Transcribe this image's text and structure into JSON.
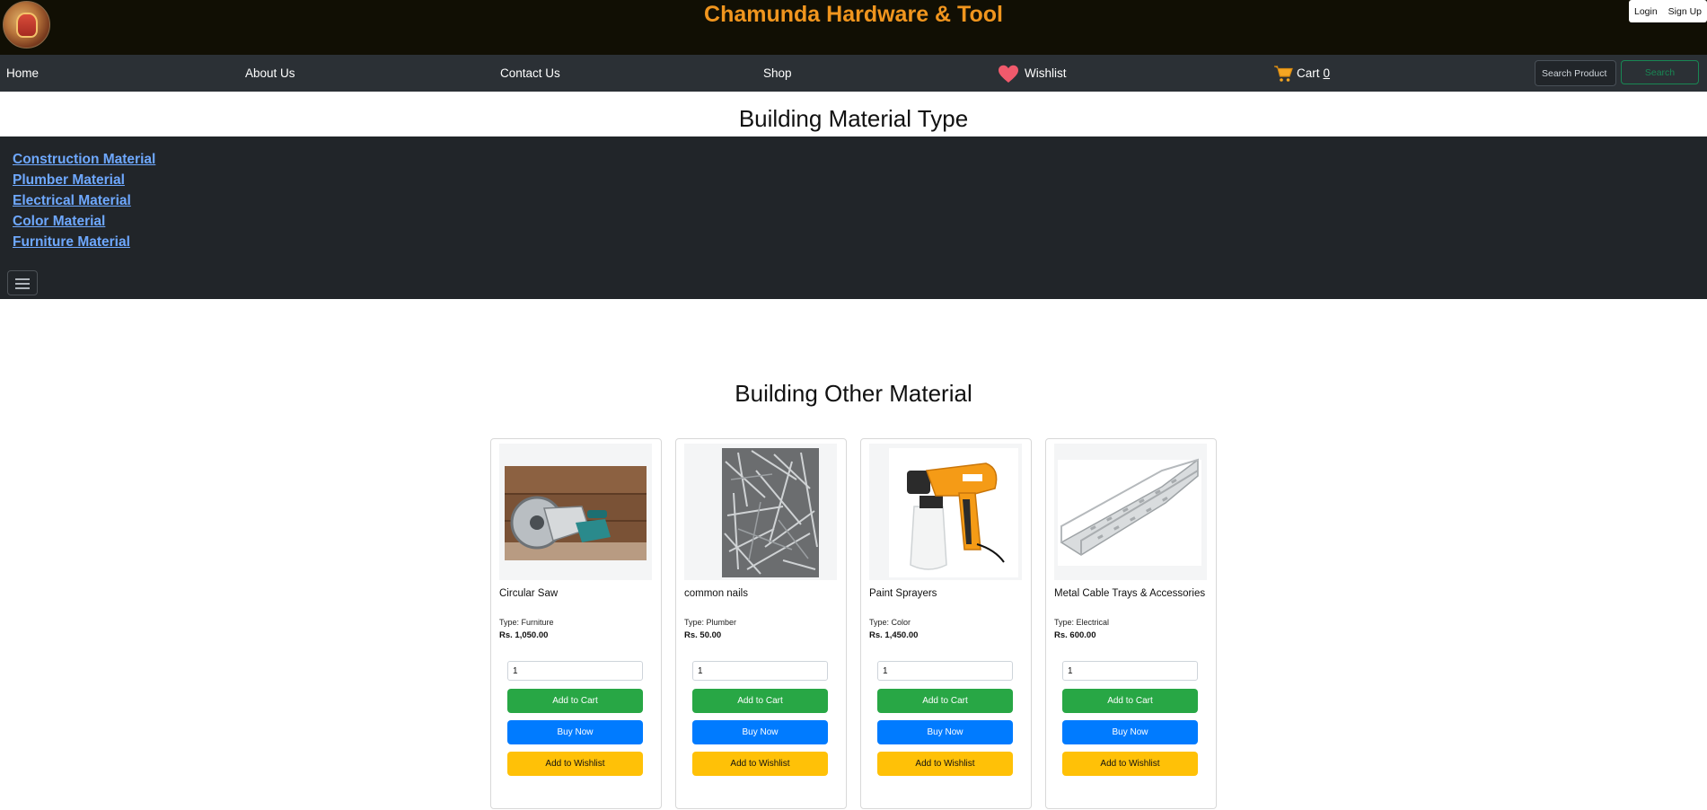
{
  "header": {
    "title": "Chamunda Hardware & Tool",
    "login_label": "Login",
    "signup_label": "Sign Up"
  },
  "nav": {
    "home": "Home",
    "about": "About Us",
    "contact": "Contact Us",
    "shop": "Shop",
    "wishlist": "Wishlist",
    "cart": "Cart",
    "cart_count": "0",
    "search_placeholder": "Search Product",
    "search_button": "Search"
  },
  "material_types": {
    "title": "Building Material Type",
    "items": [
      "Construction Material",
      "Plumber Material",
      "Electrical Material",
      "Color Material",
      "Furniture Material"
    ]
  },
  "other_material": {
    "title": "Building Other Material",
    "products": [
      {
        "name": "Circular Saw",
        "type": "Type: Furniture",
        "price": "Rs. 1,050.00",
        "qty": "1",
        "image": "circular-saw-image"
      },
      {
        "name": "common nails",
        "type": "Type: Plumber",
        "price": "Rs. 50.00",
        "qty": "1",
        "image": "nails-image"
      },
      {
        "name": "Paint Sprayers",
        "type": "Type: Color",
        "price": "Rs. 1,450.00",
        "qty": "1",
        "image": "paint-sprayer-image"
      },
      {
        "name": "Metal Cable Trays & Accessories",
        "type": "Type: Electrical",
        "price": "Rs. 600.00",
        "qty": "1",
        "image": "cable-tray-image"
      }
    ],
    "add_to_cart_label": "Add to Cart",
    "buy_now_label": "Buy Now",
    "add_to_wishlist_label": "Add to Wishlist"
  },
  "colors": {
    "header_bg": "#110f04",
    "brand_orange": "#f0951e",
    "nav_bg": "#2b3035",
    "panel_bg": "#212529",
    "link_blue": "#6ea8fe",
    "success": "#28a745",
    "primary": "#007bff",
    "warning": "#ffc107"
  }
}
